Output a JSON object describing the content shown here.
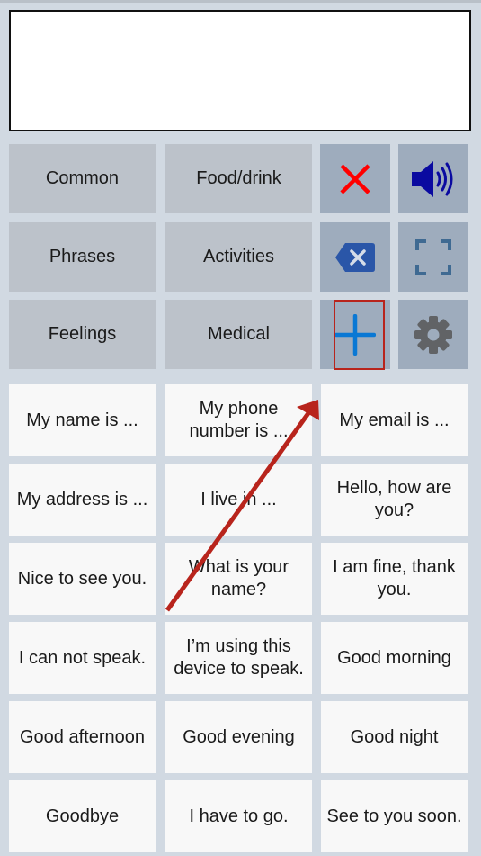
{
  "message_box": {
    "value": ""
  },
  "categories": [
    {
      "label": "Common"
    },
    {
      "label": "Food/drink"
    },
    {
      "label": "Phrases"
    },
    {
      "label": "Activities"
    },
    {
      "label": "Feelings"
    },
    {
      "label": "Medical"
    }
  ],
  "controls": [
    {
      "icon": "close-icon",
      "action": "clear"
    },
    {
      "icon": "speaker-icon",
      "action": "speak"
    },
    {
      "icon": "backspace-icon",
      "action": "delete"
    },
    {
      "icon": "fullscreen-icon",
      "action": "fullscreen"
    },
    {
      "icon": "plus-icon",
      "action": "add"
    },
    {
      "icon": "gear-icon",
      "action": "settings"
    }
  ],
  "phrases": [
    "My name is ...",
    "My phone number is ...",
    "My email is ...",
    "My address is ...",
    "I live in ...",
    "Hello, how are you?",
    "Nice to see you.",
    "What is your name?",
    "I am fine, thank you.",
    "I can not speak.",
    "I’m using this device to speak.",
    "Good morning",
    "Good afternoon",
    "Good evening",
    "Good night",
    "Goodbye",
    "I have to go.",
    "See to you soon."
  ],
  "colors": {
    "background": "#d1d9e2",
    "category_bg": "#bcc2ca",
    "control_bg": "#9eacbd",
    "phrase_bg": "#f8f8f8",
    "clear_red": "#ff0000",
    "speaker_blue": "#0a0aa0",
    "backspace_blue": "#2a56a8",
    "fullscreen_blue": "#3f6a92",
    "plus_blue": "#0a78d4",
    "gear_gray": "#616366",
    "annotation_red": "#b8241c"
  }
}
